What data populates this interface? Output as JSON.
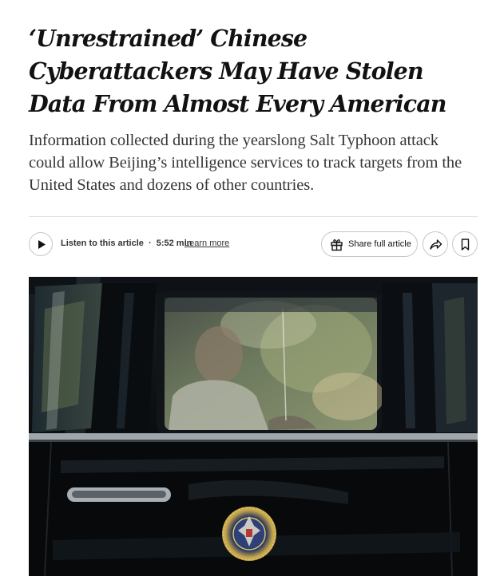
{
  "article": {
    "headline": "‘Unrestrained’ Chinese Cyberattackers May Have Stolen Data From Almost Every American",
    "summary": "Information collected during the yearslong  Salt Typhoon attack could allow Beijing’s intelligence services to track targets from the United States and dozens of other countries."
  },
  "toolbar": {
    "listen_label": "Listen to this article",
    "separator": "·",
    "duration": "5:52 min",
    "learn_more": "Learn more",
    "share_full_label": "Share full article",
    "icons": {
      "play": "play-icon",
      "gift": "gift-icon",
      "share": "share-arrow-icon",
      "save": "bookmark-icon"
    }
  },
  "photo": {
    "description_icon": "presidential-seal"
  },
  "colors": {
    "headline": "#121212",
    "summary": "#363636",
    "border": "#c7c7c7",
    "rule": "#dfdfdf"
  }
}
